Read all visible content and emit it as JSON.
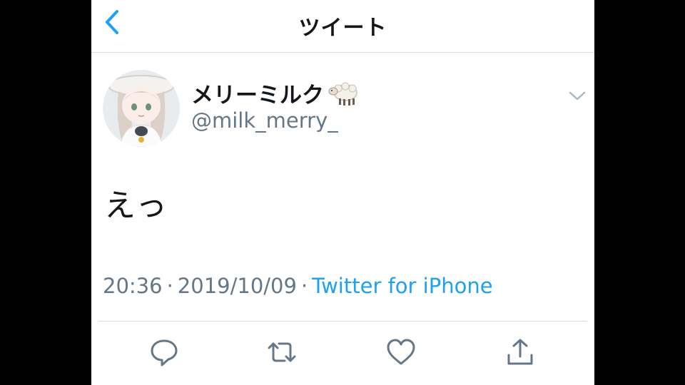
{
  "nav": {
    "title": "ツイート",
    "back_icon": "chevron-left-icon"
  },
  "tweet": {
    "display_name": "メリーミルク",
    "name_emoji": "sheep-emoji",
    "handle": "@milk_merry_",
    "text": "えっ",
    "time": "20:36",
    "date": "2019/10/09",
    "separator": "·",
    "source": "Twitter for iPhone"
  },
  "actions": {
    "reply_icon": "reply-icon",
    "retweet_icon": "retweet-icon",
    "like_icon": "heart-icon",
    "share_icon": "share-icon"
  },
  "colors": {
    "accent": "#1da1f2",
    "secondary_text": "#657786",
    "primary_text": "#14171a",
    "divider": "#d9dde1"
  }
}
